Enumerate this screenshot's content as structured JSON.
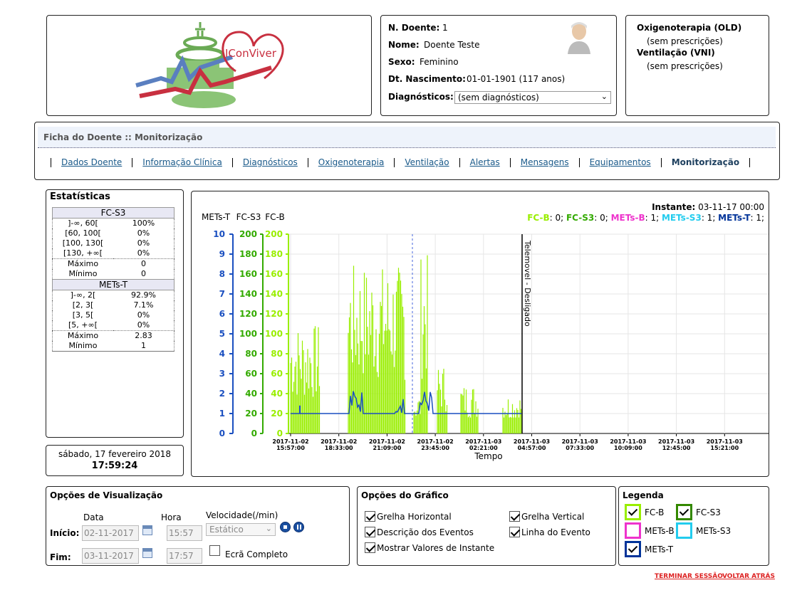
{
  "patient": {
    "id_label": "N. Doente:",
    "id": "1",
    "name_label": "Nome:",
    "name": "Doente Teste",
    "sex_label": "Sexo:",
    "sex": "Feminino",
    "dob_label": "Dt. Nascimento:",
    "dob": "01-01-1901 (117 anos)",
    "diag_label": "Diagnósticos:",
    "diag_value": "(sem diagnósticos)"
  },
  "logo_text": "IConViver",
  "therapy": {
    "oxy_title": "Oxigenoterapia (OLD)",
    "oxy_value": "(sem prescrições)",
    "vent_title": "Ventilação (VNI)",
    "vent_value": "(sem prescrições)"
  },
  "nav": {
    "title": "Ficha do Doente :: Monitorização",
    "tabs": [
      "Dados Doente",
      "Informação Clínica",
      "Diagnósticos",
      "Oxigenoterapia",
      "Ventilação",
      "Alertas",
      "Mensagens",
      "Equipamentos",
      "Monitorização"
    ],
    "active": "Monitorização"
  },
  "stats": {
    "title": "Estatísticas",
    "fcs3": {
      "name": "FC-S3",
      "rows": [
        [
          "]-∞, 60[",
          "100%"
        ],
        [
          "[60, 100[",
          "0%"
        ],
        [
          "[100, 130[",
          "0%"
        ],
        [
          "[130, +∞[",
          "0%"
        ]
      ],
      "max_label": "Máximo",
      "max": "0",
      "min_label": "Mínimo",
      "min": "0"
    },
    "metst": {
      "name": "METs-T",
      "rows": [
        [
          "]-∞, 2[",
          "92.9%"
        ],
        [
          "[2, 3[",
          "7.1%"
        ],
        [
          "[3, 5[",
          "0%"
        ],
        [
          "[5, +∞[",
          "0%"
        ]
      ],
      "max_label": "Máximo",
      "max": "2.83",
      "min_label": "Mínimo",
      "min": "1"
    }
  },
  "clock": {
    "date": "sábado, 17 fevereiro 2018",
    "time": "17:59:24"
  },
  "chart_data": {
    "type": "line",
    "instant_label": "Instante:",
    "instant_value": "03-11-17 00:00",
    "instant_values": [
      {
        "name": "FC-B",
        "value": "0",
        "color": "#99ee00"
      },
      {
        "name": "FC-S3",
        "value": "0",
        "color": "#33aa00"
      },
      {
        "name": "METs-B",
        "value": "1",
        "color": "#ee33cc"
      },
      {
        "name": "METs-S3",
        "value": "1",
        "color": "#22ccee"
      },
      {
        "name": "METs-T",
        "value": "1",
        "color": "#003399"
      }
    ],
    "axis_titles": [
      "METs-T",
      "FC-S3",
      "FC-B"
    ],
    "mets_ticks": [
      "0",
      "1",
      "2",
      "3",
      "4",
      "5",
      "6",
      "7",
      "8",
      "9",
      "10"
    ],
    "fc_ticks": [
      "0",
      "20",
      "40",
      "60",
      "80",
      "100",
      "120",
      "140",
      "160",
      "180",
      "200"
    ],
    "ylim_mets": [
      0,
      10
    ],
    "ylim_fc": [
      0,
      200
    ],
    "x_ticks": [
      [
        "2017-11-02",
        "15:57:00"
      ],
      [
        "2017-11-02",
        "18:33:00"
      ],
      [
        "2017-11-02",
        "21:09:00"
      ],
      [
        "2017-11-02",
        "23:45:00"
      ],
      [
        "2017-11-03",
        "02:21:00"
      ],
      [
        "2017-11-03",
        "04:57:00"
      ],
      [
        "2017-11-03",
        "07:33:00"
      ],
      [
        "2017-11-03",
        "10:09:00"
      ],
      [
        "2017-11-03",
        "12:45:00"
      ],
      [
        "2017-11-03",
        "15:21:00"
      ]
    ],
    "xlabel": "Tempo",
    "event_label": "Telemovel - Desligado",
    "grid": true,
    "series": [
      {
        "name": "FC-B",
        "color": "#99ee00",
        "description": "activity bursts 40-185 bpm between 15:57 and 04:57"
      },
      {
        "name": "METs-T",
        "color": "#1a4fc0",
        "baseline": 1,
        "peaks": 2.83
      }
    ]
  },
  "view_opts": {
    "title": "Opções de Visualização",
    "date_label": "Data",
    "hour_label": "Hora",
    "speed_label": "Velocidade(/min)",
    "start_label": "Início:",
    "start_date": "02-11-2017",
    "start_hour": "15:57",
    "end_label": "Fim:",
    "end_date": "03-11-2017",
    "end_hour": "17:57",
    "speed_value": "Estático",
    "fullscreen_label": "Ecrã Completo"
  },
  "graph_opts": {
    "title": "Opções do Gráfico",
    "items": [
      {
        "label": "Grelha Horizontal",
        "checked": true
      },
      {
        "label": "Grelha Vertical",
        "checked": true
      },
      {
        "label": "Descrição dos Eventos",
        "checked": true
      },
      {
        "label": "Linha do Evento",
        "checked": true
      },
      {
        "label": "Mostrar Valores de Instante",
        "checked": true
      }
    ]
  },
  "legend": {
    "title": "Legenda",
    "items": [
      {
        "label": "FC-B",
        "color": "#99ee00",
        "checked": true
      },
      {
        "label": "FC-S3",
        "color": "#338800",
        "checked": true
      },
      {
        "label": "METs-B",
        "color": "#ee33cc",
        "checked": false
      },
      {
        "label": "METs-S3",
        "color": "#22ccee",
        "checked": false
      },
      {
        "label": "METs-T",
        "color": "#003399",
        "checked": true
      }
    ]
  },
  "footer": {
    "logout": "TERMINAR SESSÃO",
    "back": "VOLTAR ATRÁS"
  }
}
